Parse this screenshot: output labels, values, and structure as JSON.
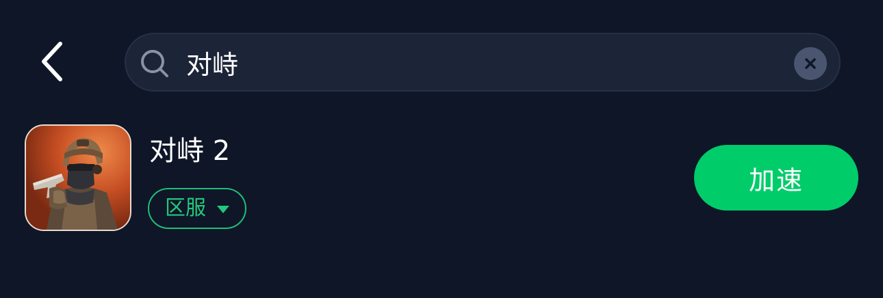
{
  "header": {
    "back_icon": "chevron-left-icon",
    "search": {
      "value": "对峙",
      "placeholder": "",
      "search_icon": "search-icon",
      "clear_icon": "close-icon"
    }
  },
  "results": [
    {
      "title": "对峙 2",
      "icon": "game-app-icon",
      "region_label": "区服",
      "region_icon": "caret-down-icon",
      "action_label": "加速"
    }
  ],
  "colors": {
    "background": "#0e1628",
    "search_bg": "#1c2437",
    "accent_green": "#00cc6a",
    "chip_green": "#22c97a"
  }
}
